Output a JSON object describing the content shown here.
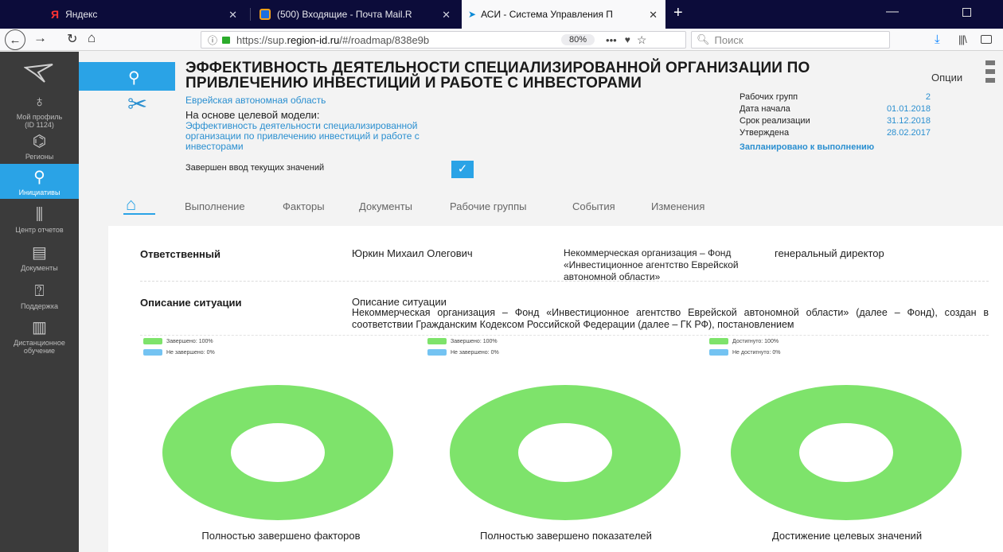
{
  "browser": {
    "tabs": [
      {
        "title": "Яндекс",
        "logo": "Я"
      },
      {
        "title": "(500) Входящие - Почта Mail.R"
      },
      {
        "title": "АСИ - Система Управления П"
      }
    ],
    "url_prefix": "https://sup.",
    "url_domain": "region-id.ru",
    "url_path": "/#/roadmap/838e9b",
    "zoom": "80%",
    "search_placeholder": "Поиск"
  },
  "sidebar": {
    "items": [
      {
        "label_line1": "Мой профиль",
        "label_line2": "(ID 1124)",
        "icon": "profile-icon"
      },
      {
        "label_line1": "Регионы",
        "label_line2": "",
        "icon": "regions-icon"
      },
      {
        "label_line1": "Инициативы",
        "label_line2": "",
        "icon": "initiatives-icon",
        "active": true
      },
      {
        "label_line1": "Центр отчетов",
        "label_line2": "",
        "icon": "reports-icon"
      },
      {
        "label_line1": "Документы",
        "label_line2": "",
        "icon": "documents-icon"
      },
      {
        "label_line1": "Поддержка",
        "label_line2": "",
        "icon": "support-icon"
      },
      {
        "label_line1": "Дистанционное",
        "label_line2": "обучение",
        "icon": "learning-icon"
      }
    ]
  },
  "header": {
    "title_line1": "ЭФФЕКТИВНОСТЬ ДЕЯТЕЛЬНОСТИ СПЕЦИАЛИЗИРОВАННОЙ ОРГАНИЗАЦИИ ПО",
    "title_line2": "ПРИВЛЕЧЕНИЮ ИНВЕСТИЦИЙ И РАБОТЕ С ИНВЕСТОРАМИ",
    "options_label": "Опции",
    "region": "Еврейская автономная область",
    "model_label": "На основе целевой модели:",
    "model_link": "Эффективность деятельности специализированной организации по привлечению инвестиций и работе с инвесторами",
    "complete_label": "Завершен ввод текущих значений"
  },
  "info": {
    "rows": [
      {
        "label": "Рабочих групп",
        "value": "2"
      },
      {
        "label": "Дата начала",
        "value": "01.01.2018"
      },
      {
        "label": "Срок реализации",
        "value": "31.12.2018"
      },
      {
        "label": "Утверждена",
        "value": "28.02.2017"
      }
    ],
    "status": "Запланировано к выполнению"
  },
  "tabs": [
    "Выполнение",
    "Факторы",
    "Документы",
    "Рабочие группы",
    "События",
    "Изменения"
  ],
  "responsible": {
    "label": "Ответственный",
    "name": "Юркин Михаил Олегович",
    "org": "Некоммерческая организация – Фонд «Инвестиционное агентство Еврейской автономной области»",
    "position": "генеральный директор"
  },
  "situation": {
    "label": "Описание ситуации",
    "title": "Описание ситуации",
    "text": "Некоммерческая организация – Фонд «Инвестиционное агентство Еврейской автономной области» (далее – Фонд), создан в соответствии Гражданским Кодексом Российской Федерации (далее – ГК РФ), постановлением"
  },
  "colors": {
    "done": "#7ee36b",
    "not_done": "#74c3f2",
    "accent": "#2aa3e6"
  },
  "chart_data": [
    {
      "type": "pie",
      "title": "Полностью завершено факторов",
      "labels": [
        "Завершено: 100%",
        "Не завершено: 0%"
      ],
      "values": [
        100,
        0
      ]
    },
    {
      "type": "pie",
      "title": "Полностью завершено показателей",
      "labels": [
        "Завершено: 100%",
        "Не завершено: 0%"
      ],
      "values": [
        100,
        0
      ]
    },
    {
      "type": "pie",
      "title": "Достижение целевых значений",
      "labels": [
        "Достигнуто: 100%",
        "Не достигнуто: 0%"
      ],
      "values": [
        100,
        0
      ]
    }
  ]
}
